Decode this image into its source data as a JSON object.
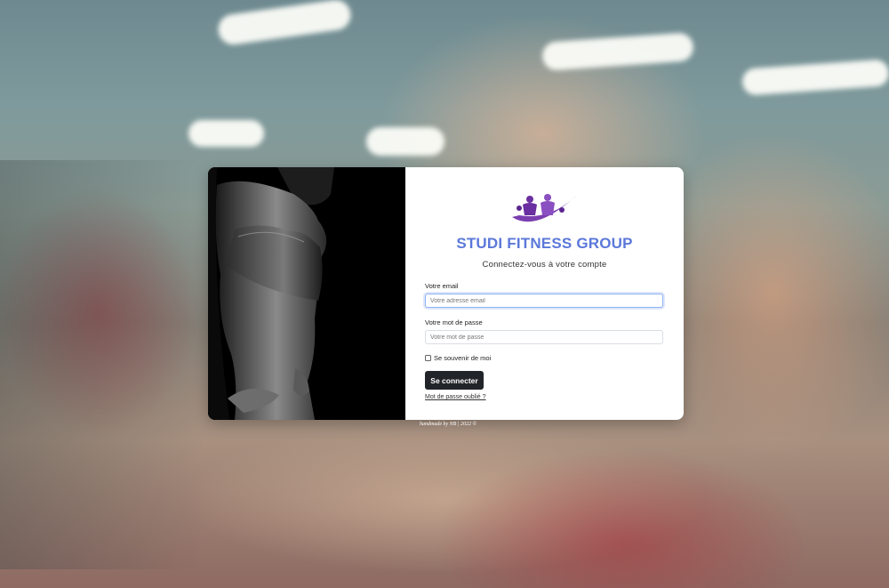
{
  "page": {
    "brand_title": "STUDI FITNESS GROUP",
    "subtitle": "Connectez-vous à votre compte",
    "brand_color": "#5b78d9",
    "logo_icon": "athletes-swoosh-logo",
    "hero_image": "woman-athlete-photo"
  },
  "form": {
    "email_label": "Votre email",
    "email_placeholder": "Votre adresse email",
    "email_value": "",
    "password_label": "Votre mot de passe",
    "password_placeholder": "Votre mot de passe",
    "password_value": "",
    "remember_label": "Se souvenir de moi",
    "remember_checked": false,
    "submit_label": "Se connecter",
    "forgot_link": "Mot de passe oublié ?"
  },
  "footer": {
    "credit": "handmade by NB | 2022 ©"
  }
}
